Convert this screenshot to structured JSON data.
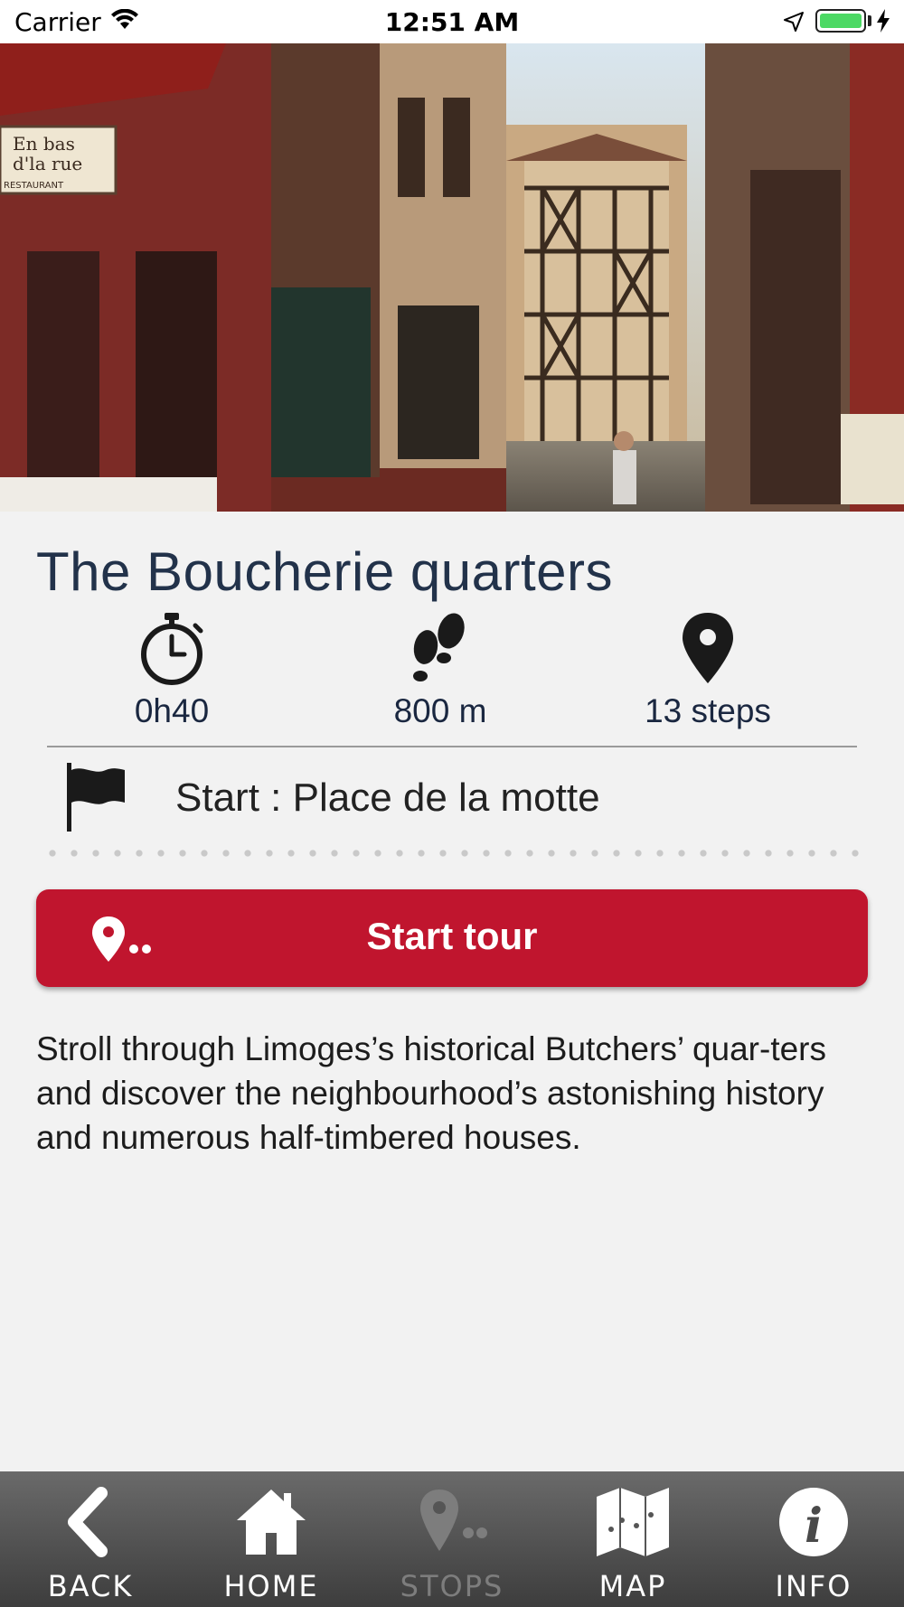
{
  "status_bar": {
    "carrier": "Carrier",
    "time": "12:51 AM",
    "battery_level": 1.0
  },
  "hero": {
    "sign_text_1": "En bas",
    "sign_text_2": "d'la rue",
    "sign_text_3": "RESTAURANT"
  },
  "tour": {
    "title": "The Boucherie quarters",
    "stats": [
      {
        "icon": "stopwatch-icon",
        "value": "0h40"
      },
      {
        "icon": "footsteps-icon",
        "value": "800 m"
      },
      {
        "icon": "map-pin-icon",
        "value": "13 steps"
      }
    ],
    "start_point": "Start : Place de la motte",
    "start_button_label": "Start tour",
    "description": "Stroll through Limoges’s historical Butchers’ quar-ters and discover the neighbourhood’s astonishing history and numerous half-timbered houses."
  },
  "tabbar": [
    {
      "label": "BACK",
      "icon": "chevron-left-icon",
      "enabled": true
    },
    {
      "label": "HOME",
      "icon": "home-icon",
      "enabled": true
    },
    {
      "label": "STOPS",
      "icon": "stops-pin-icon",
      "enabled": false
    },
    {
      "label": "MAP",
      "icon": "map-icon",
      "enabled": true
    },
    {
      "label": "INFO",
      "icon": "info-icon",
      "enabled": true
    }
  ],
  "colors": {
    "accent": "#c0152e",
    "title": "#22324a",
    "tabbar": "#4a4a4a"
  }
}
